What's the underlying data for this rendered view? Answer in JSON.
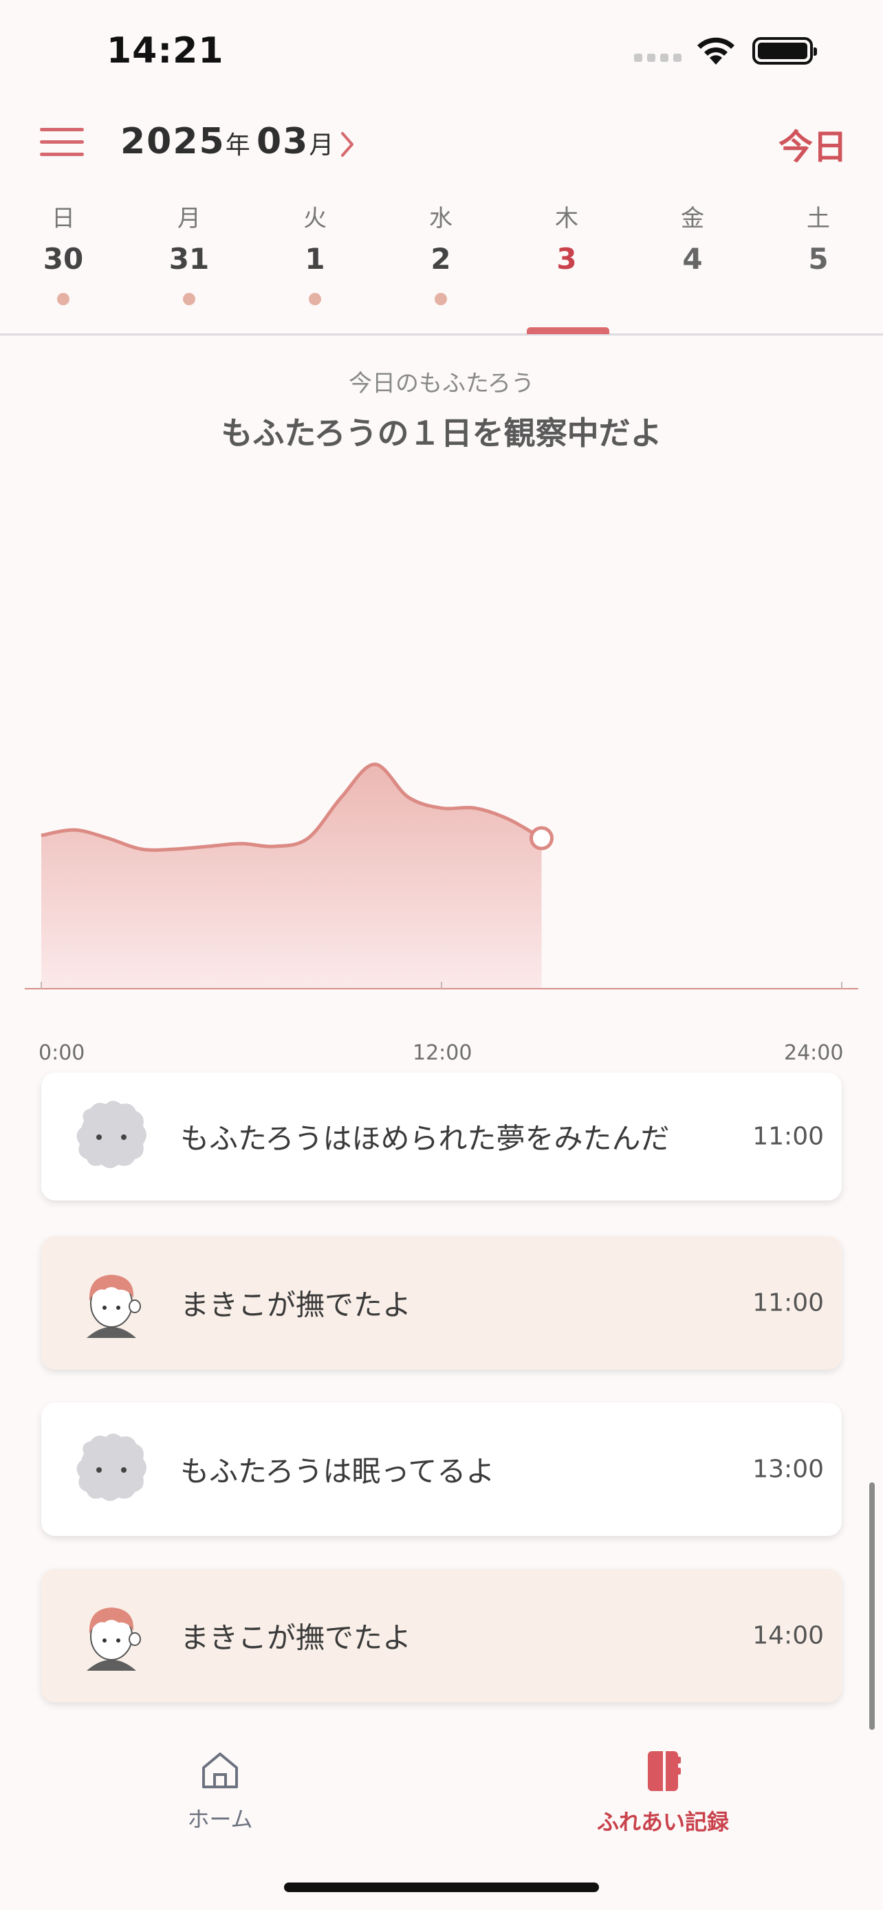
{
  "status_bar": {
    "time": "14:21"
  },
  "header": {
    "year": "2025",
    "year_unit": "年",
    "month": "03",
    "month_unit": "月",
    "today_label": "今日"
  },
  "week": [
    {
      "name": "日",
      "num": "30",
      "has_dot": true,
      "selected": false
    },
    {
      "name": "月",
      "num": "31",
      "has_dot": true,
      "selected": false
    },
    {
      "name": "火",
      "num": "1",
      "has_dot": true,
      "selected": false
    },
    {
      "name": "水",
      "num": "2",
      "has_dot": true,
      "selected": false
    },
    {
      "name": "木",
      "num": "3",
      "has_dot": false,
      "selected": true
    },
    {
      "name": "金",
      "num": "4",
      "has_dot": false,
      "selected": false
    },
    {
      "name": "土",
      "num": "5",
      "has_dot": false,
      "selected": false
    }
  ],
  "heading": {
    "subtitle": "今日のもふたろう",
    "title": "もふたろうの１日を観察中だよ"
  },
  "chart_data": {
    "type": "area",
    "x_ticks": [
      "0:00",
      "12:00",
      "24:00"
    ],
    "x_range_hours": [
      0,
      24
    ],
    "y_range": [
      0,
      100
    ],
    "ylabel": "",
    "series": [
      {
        "x": [
          0,
          1,
          2,
          3,
          4,
          5,
          6,
          7,
          8,
          9,
          10,
          11,
          12,
          13,
          14,
          15
        ],
        "values": [
          56,
          58,
          55,
          51,
          51,
          52,
          53,
          52,
          55,
          70,
          82,
          70,
          66,
          66,
          62,
          55
        ]
      }
    ],
    "colors": {
      "line": "#dc8a84",
      "fill_top": "#ecb8b3",
      "fill_bottom": "#fbe9ea"
    }
  },
  "events": [
    {
      "avatar": "mofutaro",
      "text": "もふたろうはほめられた夢をみたんだ",
      "time": "11:00",
      "style": "white"
    },
    {
      "avatar": "makiko",
      "text": "まきこが撫でたよ",
      "time": "11:00",
      "style": "cream"
    },
    {
      "avatar": "mofutaro",
      "text": "もふたろうは眠ってるよ",
      "time": "13:00",
      "style": "white"
    },
    {
      "avatar": "makiko",
      "text": "まきこが撫でたよ",
      "time": "14:00",
      "style": "cream"
    }
  ],
  "tabs": {
    "home_label": "ホーム",
    "records_label": "ふれあい記録"
  },
  "colors": {
    "accent": "#c9424c",
    "background": "#fcf9f8",
    "card_cream": "#f9efe8"
  }
}
